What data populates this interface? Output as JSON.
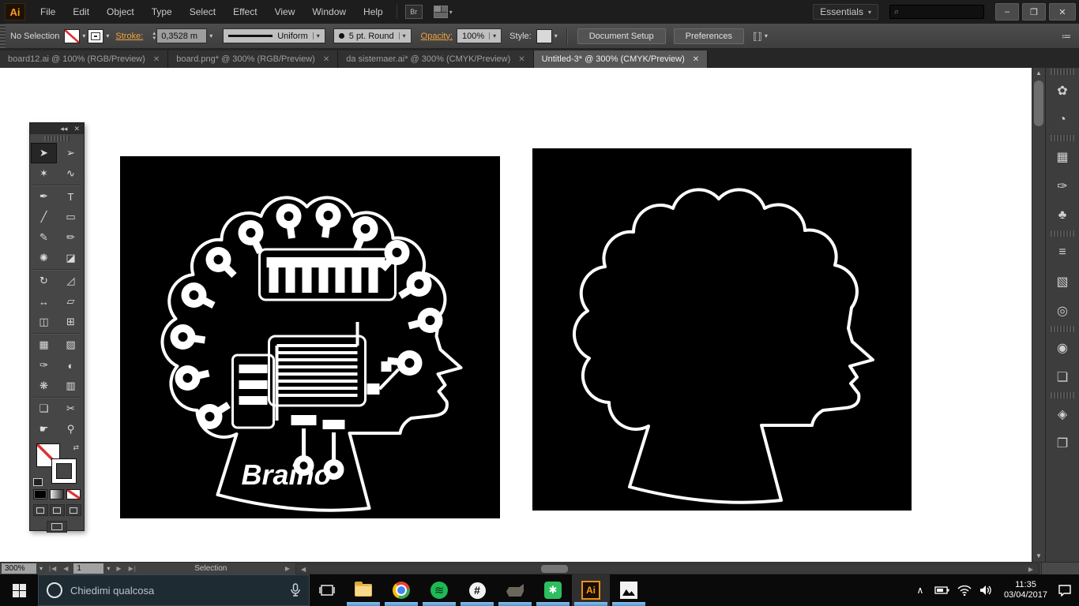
{
  "app": {
    "logo": "Ai"
  },
  "glyphs": {
    "minimize": "–",
    "restore": "❐",
    "close": "✕",
    "search": "⌕",
    "dd": "▾",
    "up": "▲",
    "down": "▼",
    "left": "◀",
    "right": "▶",
    "collapse": "◂◂",
    "x": "✕",
    "first": "|◀",
    "last": "▶|",
    "swap": "⇄",
    "panel_menu": "≔",
    "chevron_up": "∧",
    "tab_close": "✕"
  },
  "menubar": {
    "items": [
      "File",
      "Edit",
      "Object",
      "Type",
      "Select",
      "Effect",
      "View",
      "Window",
      "Help"
    ],
    "workspace": "Essentials"
  },
  "controlbar": {
    "selection_status": "No Selection",
    "stroke_label": "Stroke:",
    "stroke_value": "0,3528 m",
    "variable_width": "Uniform",
    "brush_dot": "●",
    "brush": "5 pt. Round",
    "opacity_label": "Opacity:",
    "opacity_value": "100%",
    "style_label": "Style:",
    "document_setup": "Document Setup",
    "preferences": "Preferences"
  },
  "tabs": [
    {
      "label": "board12.ai @ 100% (RGB/Preview)",
      "active": false
    },
    {
      "label": "board.png* @ 300% (RGB/Preview)",
      "active": false
    },
    {
      "label": "da sistemaer.ai* @ 300% (CMYK/Preview)",
      "active": false
    },
    {
      "label": "Untitled-3* @ 300% (CMYK/Preview)",
      "active": true
    }
  ],
  "toolbar": {
    "tools": [
      {
        "name": "selection",
        "glyph": "➤"
      },
      {
        "name": "direct-selection",
        "glyph": "➢"
      },
      {
        "name": "magic-wand",
        "glyph": "✶"
      },
      {
        "name": "lasso",
        "glyph": "∿"
      },
      {
        "name": "pen",
        "glyph": "✒"
      },
      {
        "name": "type",
        "glyph": "T"
      },
      {
        "name": "line-segment",
        "glyph": "╱"
      },
      {
        "name": "rectangle",
        "glyph": "▭"
      },
      {
        "name": "paintbrush",
        "glyph": "✎"
      },
      {
        "name": "pencil",
        "glyph": "✏"
      },
      {
        "name": "blob-brush",
        "glyph": "✺"
      },
      {
        "name": "eraser",
        "glyph": "◪"
      },
      {
        "name": "rotate",
        "glyph": "↻"
      },
      {
        "name": "scale",
        "glyph": "◿"
      },
      {
        "name": "width",
        "glyph": "↔"
      },
      {
        "name": "free-transform",
        "glyph": "▱"
      },
      {
        "name": "shape-builder",
        "glyph": "◫"
      },
      {
        "name": "perspective-grid",
        "glyph": "⊞"
      },
      {
        "name": "mesh",
        "glyph": "▦"
      },
      {
        "name": "gradient",
        "glyph": "▨"
      },
      {
        "name": "eyedropper",
        "glyph": "✑"
      },
      {
        "name": "blend",
        "glyph": "◐"
      },
      {
        "name": "symbol-sprayer",
        "glyph": "❋"
      },
      {
        "name": "column-graph",
        "glyph": "▥"
      },
      {
        "name": "artboard",
        "glyph": "❏"
      },
      {
        "name": "slice",
        "glyph": "✂"
      },
      {
        "name": "hand",
        "glyph": "☛"
      },
      {
        "name": "zoom",
        "glyph": "⚲"
      }
    ]
  },
  "dock": {
    "panels": [
      {
        "name": "color",
        "glyph": "✿"
      },
      {
        "name": "color-guide",
        "glyph": "◔"
      },
      {
        "name": "swatches",
        "glyph": "▦"
      },
      {
        "name": "brushes",
        "glyph": "✑"
      },
      {
        "name": "symbols",
        "glyph": "♣"
      },
      {
        "name": "stroke",
        "glyph": "≡"
      },
      {
        "name": "gradient",
        "glyph": "▧"
      },
      {
        "name": "transparency",
        "glyph": "◎"
      },
      {
        "name": "appearance",
        "glyph": "◉"
      },
      {
        "name": "artboards",
        "glyph": "❏"
      },
      {
        "name": "layers",
        "glyph": "◈"
      },
      {
        "name": "links",
        "glyph": "❐"
      }
    ]
  },
  "canvas": {
    "artboard_title": "Braino"
  },
  "statusbar": {
    "zoom": "300%",
    "artboard_number": "1",
    "status": "Selection"
  },
  "taskbar": {
    "search_placeholder": "Chiedimi qualcosa",
    "apps": [
      "file-explorer",
      "chrome",
      "spotify",
      "music-hash",
      "game",
      "evernote",
      "illustrator",
      "photos"
    ],
    "hash_glyph": "#",
    "evernote_glyph": "✱",
    "ai_glyph": "Ai",
    "tray": {
      "time": "11:35",
      "date": "03/04/2017"
    }
  }
}
